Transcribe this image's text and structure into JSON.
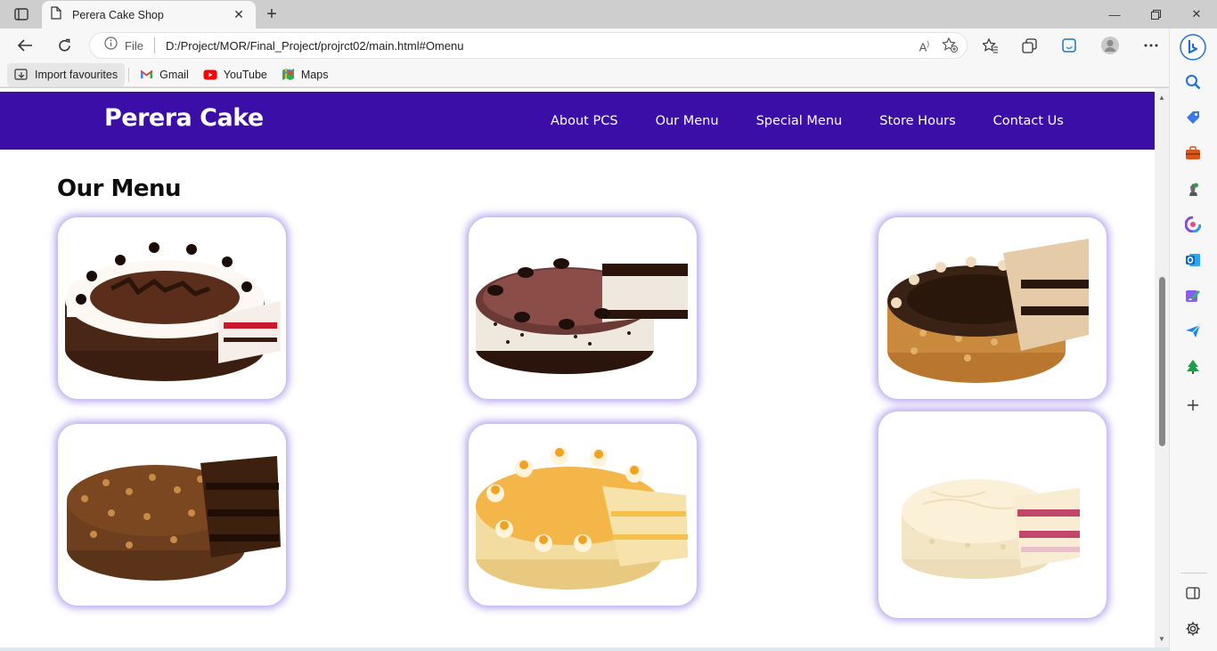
{
  "browser": {
    "tab_title": "Perera Cake Shop",
    "address_file_label": "File",
    "url": "D:/Project/MOR/Final_Project/projrct02/main.html#Omenu",
    "favourites": [
      {
        "label": "Import favourites",
        "icon": "import-icon"
      },
      {
        "label": "Gmail",
        "icon": "gmail-icon"
      },
      {
        "label": "YouTube",
        "icon": "youtube-icon"
      },
      {
        "label": "Maps",
        "icon": "maps-icon"
      }
    ]
  },
  "site": {
    "brand": "Perera Cake",
    "nav": [
      "About PCS",
      "Our Menu",
      "Special Menu",
      "Store Hours",
      "Contact Us"
    ],
    "section_title": "Our Menu",
    "menu_cards": [
      {
        "name": "black-forest-cake"
      },
      {
        "name": "oreo-cheesecake"
      },
      {
        "name": "chocolate-almond-cake"
      },
      {
        "name": "chocolate-hazelnut-cake"
      },
      {
        "name": "orange-cream-cake"
      },
      {
        "name": "white-chocolate-raspberry-cake"
      }
    ]
  },
  "colors": {
    "navbar": "#3b0ea8",
    "card_glow": "#785adc"
  }
}
